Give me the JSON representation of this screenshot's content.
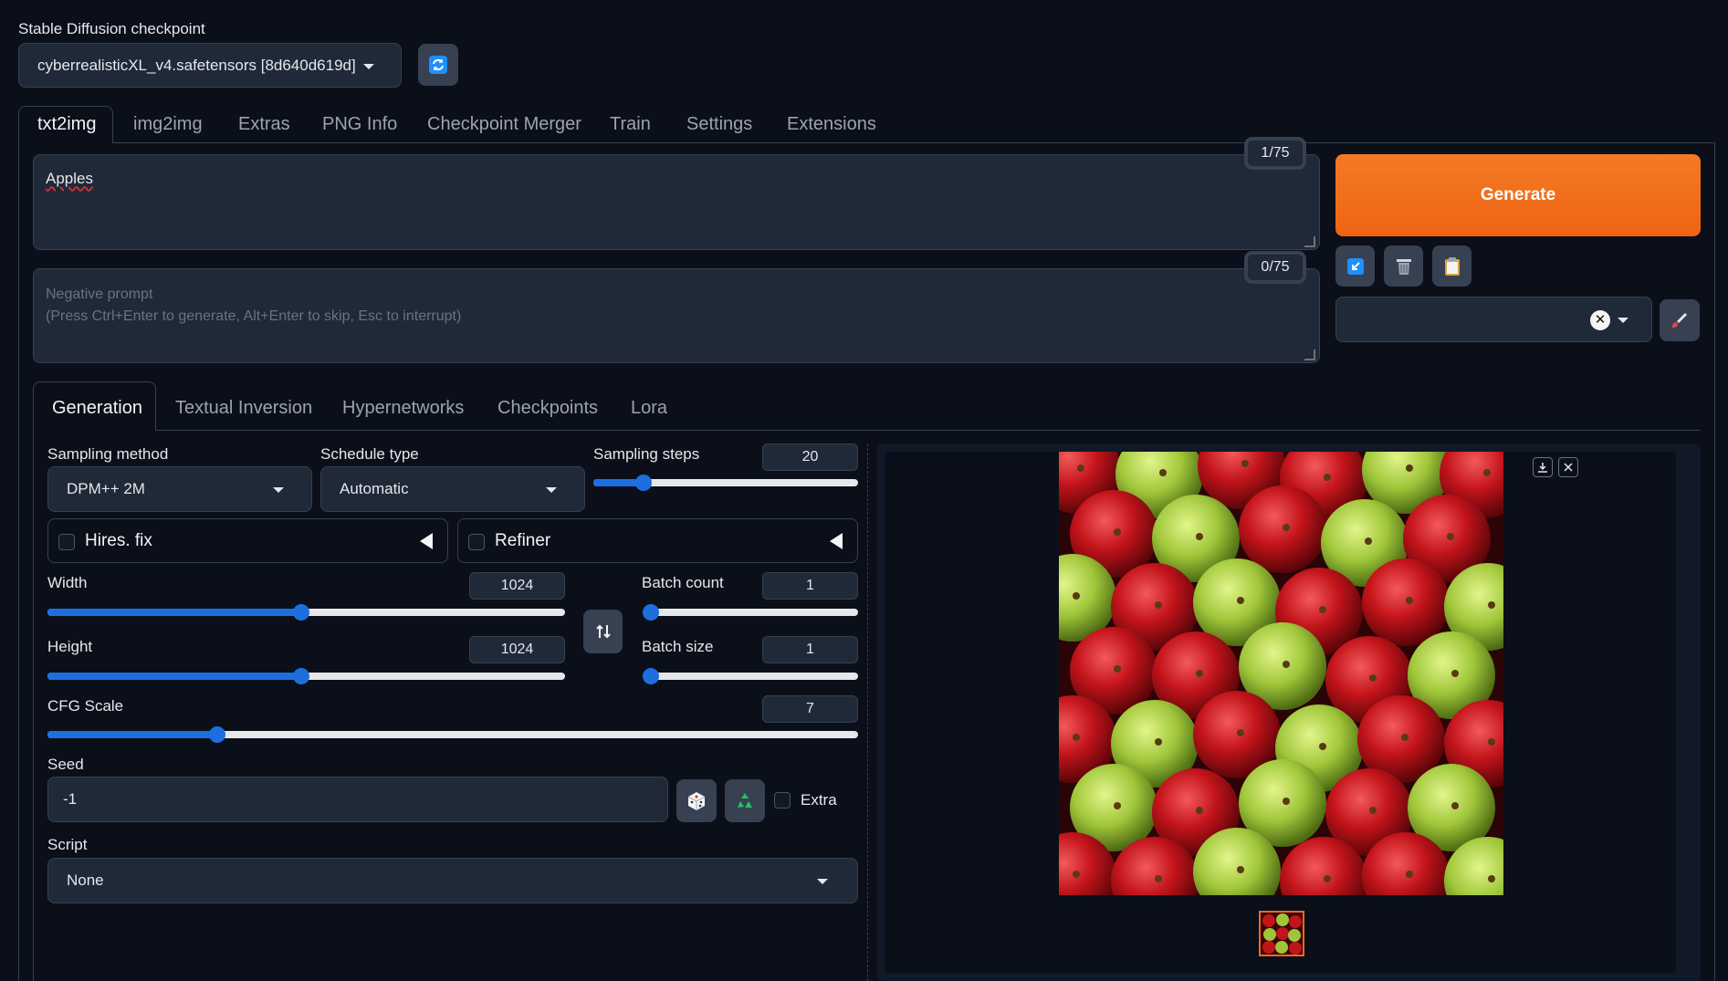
{
  "checkpoint": {
    "label": "Stable Diffusion checkpoint",
    "value": "cyberrealisticXL_v4.safetensors [8d640d619d]"
  },
  "main_tabs": [
    "txt2img",
    "img2img",
    "Extras",
    "PNG Info",
    "Checkpoint Merger",
    "Train",
    "Settings",
    "Extensions"
  ],
  "prompt": {
    "value": "Apples",
    "token_count": "1/75"
  },
  "negative_prompt": {
    "placeholder_line1": "Negative prompt",
    "placeholder_line2": "(Press Ctrl+Enter to generate, Alt+Enter to skip, Esc to interrupt)",
    "token_count": "0/75"
  },
  "generate_label": "Generate",
  "sub_tabs": [
    "Generation",
    "Textual Inversion",
    "Hypernetworks",
    "Checkpoints",
    "Lora"
  ],
  "generation": {
    "sampling_method": {
      "label": "Sampling method",
      "value": "DPM++ 2M"
    },
    "schedule_type": {
      "label": "Schedule type",
      "value": "Automatic"
    },
    "sampling_steps": {
      "label": "Sampling steps",
      "value": "20",
      "fraction": 0.19
    },
    "hires_fix": {
      "label": "Hires. fix"
    },
    "refiner": {
      "label": "Refiner"
    },
    "width": {
      "label": "Width",
      "value": "1024",
      "fraction": 0.49
    },
    "height": {
      "label": "Height",
      "value": "1024",
      "fraction": 0.49
    },
    "batch_count": {
      "label": "Batch count",
      "value": "1",
      "fraction": 0.0
    },
    "batch_size": {
      "label": "Batch size",
      "value": "1",
      "fraction": 0.0
    },
    "cfg_scale": {
      "label": "CFG Scale",
      "value": "7",
      "fraction": 0.21
    },
    "seed": {
      "label": "Seed",
      "value": "-1",
      "extra_label": "Extra"
    },
    "script": {
      "label": "Script",
      "value": "None"
    }
  },
  "colors": {
    "accent": "#1d6fe0",
    "generate": "#f26a1b",
    "background": "#0b0f19",
    "panel": "#1f2937"
  }
}
